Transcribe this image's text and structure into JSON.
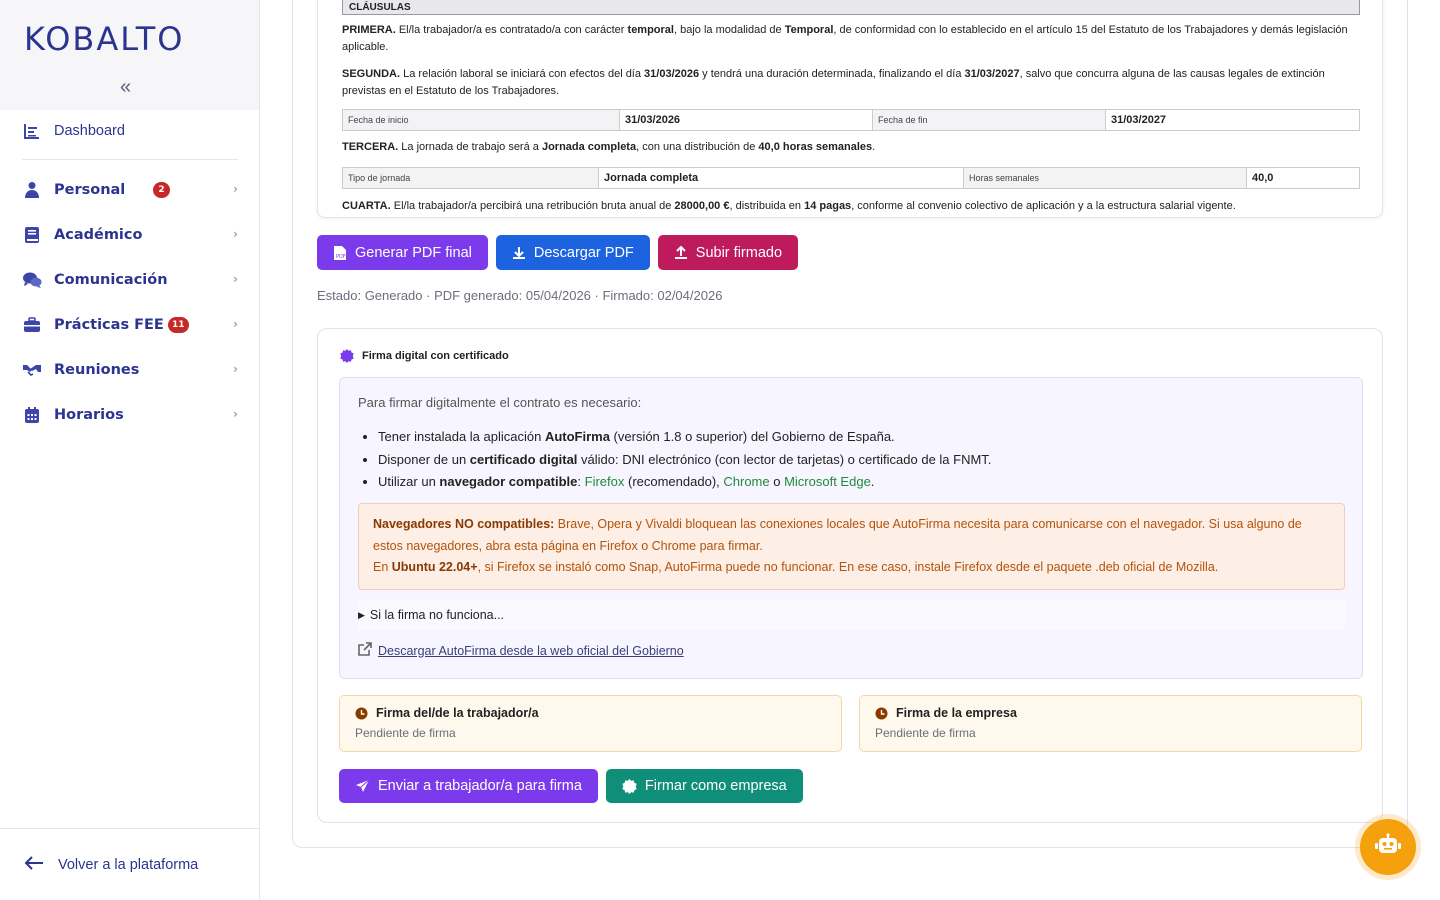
{
  "sidebar": {
    "logo": "KOBALTO",
    "collapse_icon": "«",
    "items": [
      {
        "label": "Dashboard",
        "icon": "dashboard-icon"
      },
      {
        "label": "Personal",
        "icon": "person-icon",
        "badge": "2"
      },
      {
        "label": "Académico",
        "icon": "book-icon"
      },
      {
        "label": "Comunicación",
        "icon": "chat-icon"
      },
      {
        "label": "Prácticas FEE",
        "icon": "briefcase-icon",
        "badge": "11"
      },
      {
        "label": "Reuniones",
        "icon": "handshake-icon"
      },
      {
        "label": "Horarios",
        "icon": "calendar-icon"
      }
    ],
    "back_label": "Volver a la plataforma"
  },
  "doc": {
    "section": "CLÁUSULAS",
    "primera_head": "PRIMERA.",
    "primera_1": " El/la trabajador/a es contratado/a con carácter ",
    "primera_b1": "temporal",
    "primera_2": ", bajo la modalidad de ",
    "primera_b2": "Temporal",
    "primera_3": ", de conformidad con lo establecido en el artículo 15 del Estatuto de los Trabajadores y demás legislación aplicable.",
    "segunda_head": "SEGUNDA.",
    "segunda_1": " La relación laboral se iniciará con efectos del día ",
    "segunda_b1": "31/03/2026",
    "segunda_2": " y tendrá una duración determinada, finalizando el día ",
    "segunda_b2": "31/03/2027",
    "segunda_3": ", salvo que concurra alguna de las causas legales de extinción previstas en el Estatuto de los Trabajadores.",
    "table1": {
      "k1": "Fecha de inicio",
      "v1": "31/03/2026",
      "k2": "Fecha de fin",
      "v2": "31/03/2027"
    },
    "tercera_head": "TERCERA.",
    "tercera_1": " La jornada de trabajo será a ",
    "tercera_b1": "Jornada completa",
    "tercera_2": ", con una distribución de ",
    "tercera_b2": "40,0 horas semanales",
    "tercera_3": ".",
    "table2": {
      "k1": "Tipo de jornada",
      "v1": "Jornada completa",
      "k2": "Horas semanales",
      "v2": "40,0"
    },
    "cuarta_head": "CUARTA.",
    "cuarta_1": " El/la trabajador/a percibirá una retribución bruta anual de ",
    "cuarta_b1": "28000,00 €",
    "cuarta_2": ", distribuida en ",
    "cuarta_b2": "14 pagas",
    "cuarta_3": ", conforme al convenio colectivo de aplicación y a la estructura salarial vigente."
  },
  "actions": {
    "generate": "Generar PDF final",
    "download": "Descargar PDF",
    "upload": "Subir firmado",
    "colors": {
      "generate": "#7c3aed",
      "download": "#1d63e0",
      "upload": "#be1b5c"
    }
  },
  "status": "Estado: Generado · PDF generado: 05/04/2026 · Firmado: 02/04/2026",
  "sign": {
    "title": "Firma digital con certificado",
    "intro": "Para firmar digitalmente el contrato es necesario:",
    "req1_a": "Tener instalada la aplicación ",
    "req1_b": "AutoFirma",
    "req1_c": " (versión 1.8 o superior) del Gobierno de España.",
    "req2_a": "Disponer de un ",
    "req2_b": "certificado digital",
    "req2_c": " válido: DNI electrónico (con lector de tarjetas) o certificado de la FNMT.",
    "req3_a": "Utilizar un ",
    "req3_b": "navegador compatible",
    "req3_c": ": ",
    "req3_firefox": "Firefox",
    "req3_d": " (recomendado), ",
    "req3_chrome": "Chrome",
    "req3_e": " o ",
    "req3_edge": "Microsoft Edge",
    "req3_f": ".",
    "warn_head": "Navegadores NO compatibles:",
    "warn_1": " Brave, Opera y Vivaldi bloquean las conexiones locales que AutoFirma necesita para comunicarse con el navegador. Si usa alguno de estos navegadores, abra esta página en Firefox o Chrome para firmar.",
    "warn_2a": "En ",
    "warn_2b": "Ubuntu 22.04+",
    "warn_2c": ", si Firefox se instaló como Snap, AutoFirma puede no funcionar. En ese caso, instale Firefox desde el paquete .deb oficial de Mozilla.",
    "details": "Si la firma no funciona...",
    "download_link": "Descargar AutoFirma desde la web oficial del Gobierno",
    "worker_title": "Firma del/de la trabajador/a",
    "worker_status": "Pendiente de firma",
    "company_title": "Firma de la empresa",
    "company_status": "Pendiente de firma",
    "send_btn": "Enviar a trabajador/a para firma",
    "sign_btn": "Firmar como empresa",
    "colors": {
      "send": "#7c3aed",
      "sign": "#0f8f7a"
    }
  }
}
